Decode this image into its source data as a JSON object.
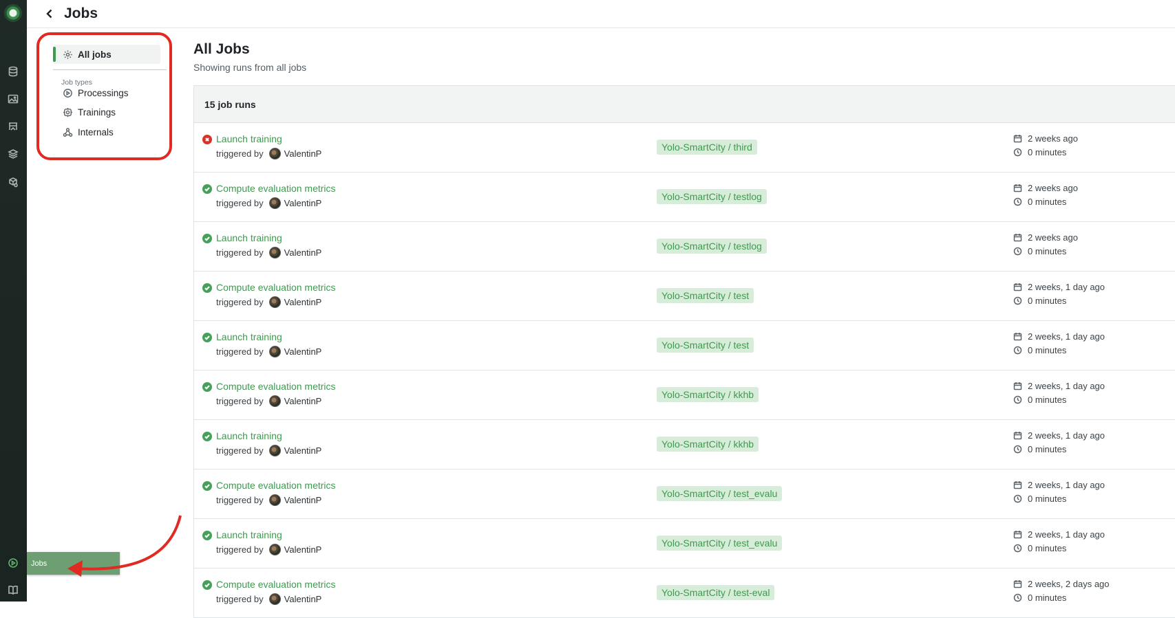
{
  "header": {
    "title": "Jobs"
  },
  "sidenav": {
    "active_label": "All jobs",
    "group_label": "Job types",
    "items": [
      {
        "label": "Processings",
        "icon": "play-circle-icon"
      },
      {
        "label": "Trainings",
        "icon": "gear-icon"
      },
      {
        "label": "Internals",
        "icon": "webhook-icon"
      }
    ]
  },
  "main": {
    "title": "All Jobs",
    "subtitle": "Showing runs from all jobs",
    "count_label": "15 job runs",
    "triggered_label": "triggered by",
    "rows": [
      {
        "status": "error",
        "name": "Launch training",
        "user": "ValentinP",
        "tag": "Yolo-SmartCity / third",
        "date": "2 weeks ago",
        "duration": "0 minutes"
      },
      {
        "status": "success",
        "name": "Compute evaluation metrics",
        "user": "ValentinP",
        "tag": "Yolo-SmartCity / testlog",
        "date": "2 weeks ago",
        "duration": "0 minutes"
      },
      {
        "status": "success",
        "name": "Launch training",
        "user": "ValentinP",
        "tag": "Yolo-SmartCity / testlog",
        "date": "2 weeks ago",
        "duration": "0 minutes"
      },
      {
        "status": "success",
        "name": "Compute evaluation metrics",
        "user": "ValentinP",
        "tag": "Yolo-SmartCity / test",
        "date": "2 weeks, 1 day ago",
        "duration": "0 minutes"
      },
      {
        "status": "success",
        "name": "Launch training",
        "user": "ValentinP",
        "tag": "Yolo-SmartCity / test",
        "date": "2 weeks, 1 day ago",
        "duration": "0 minutes"
      },
      {
        "status": "success",
        "name": "Compute evaluation metrics",
        "user": "ValentinP",
        "tag": "Yolo-SmartCity / kkhb",
        "date": "2 weeks, 1 day ago",
        "duration": "0 minutes"
      },
      {
        "status": "success",
        "name": "Launch training",
        "user": "ValentinP",
        "tag": "Yolo-SmartCity / kkhb",
        "date": "2 weeks, 1 day ago",
        "duration": "0 minutes"
      },
      {
        "status": "success",
        "name": "Compute evaluation metrics",
        "user": "ValentinP",
        "tag": "Yolo-SmartCity / test_evalu",
        "date": "2 weeks, 1 day ago",
        "duration": "0 minutes"
      },
      {
        "status": "success",
        "name": "Launch training",
        "user": "ValentinP",
        "tag": "Yolo-SmartCity / test_evalu",
        "date": "2 weeks, 1 day ago",
        "duration": "0 minutes"
      },
      {
        "status": "success",
        "name": "Compute evaluation metrics",
        "user": "ValentinP",
        "tag": "Yolo-SmartCity / test-eval",
        "date": "2 weeks, 2 days ago",
        "duration": "0 minutes"
      }
    ]
  },
  "tooltip": {
    "label": "Jobs"
  },
  "colors": {
    "accent": "#3f9a4f",
    "error": "#d9322b",
    "annotation": "#e02a22",
    "rail": "#1f2a26"
  },
  "rail_icons": [
    "logo",
    "database-icon",
    "image-icon",
    "experiment-icon",
    "layers-icon",
    "deploy-icon",
    "jobs-icon",
    "docs-icon"
  ]
}
